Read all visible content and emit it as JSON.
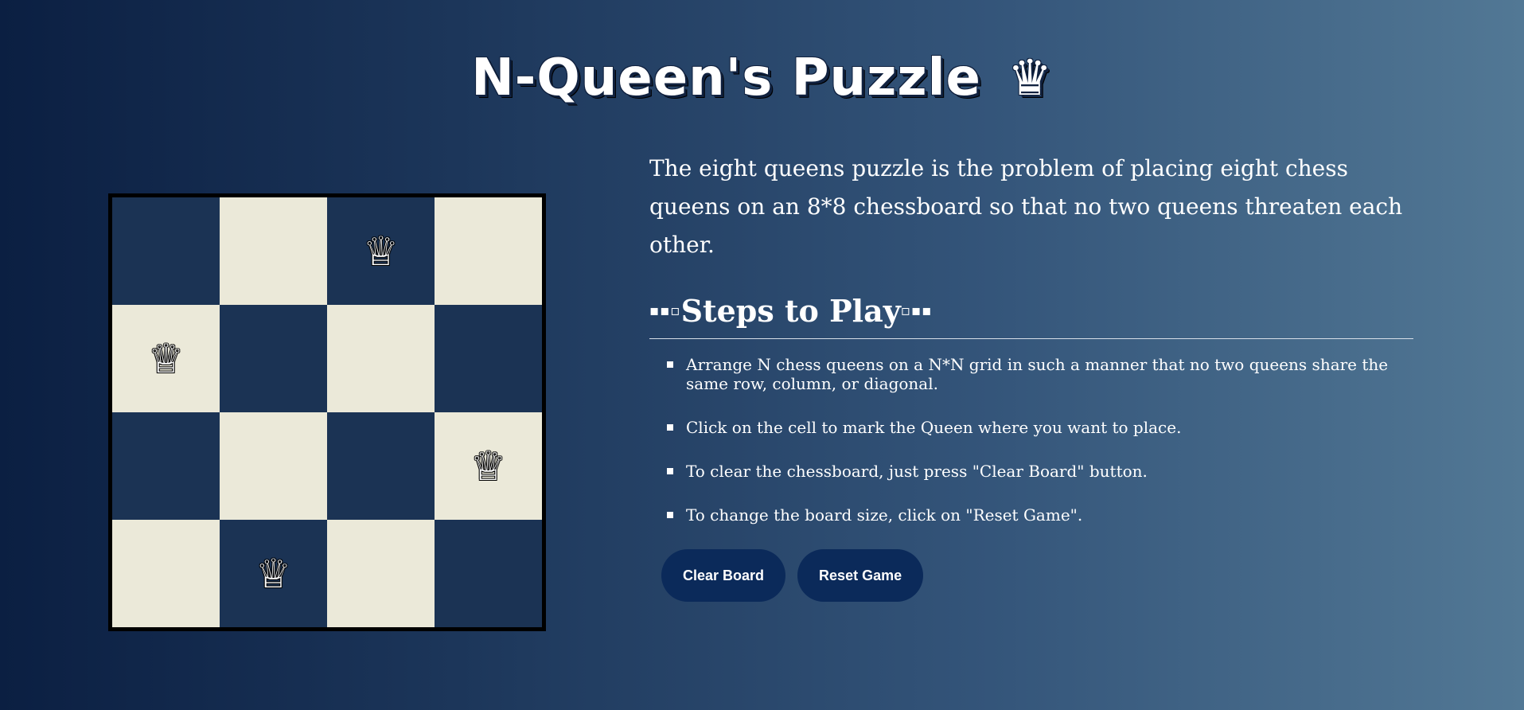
{
  "header": {
    "title": "N-Queen's Puzzle",
    "crown_icon": "♛"
  },
  "board": {
    "size": 4,
    "queen_glyph": "♕",
    "cells": [
      [
        "dark",
        "light",
        "dark",
        "light"
      ],
      [
        "light",
        "dark",
        "light",
        "dark"
      ],
      [
        "dark",
        "light",
        "dark",
        "light"
      ],
      [
        "light",
        "dark",
        "light",
        "dark"
      ]
    ],
    "queens": [
      {
        "row": 0,
        "col": 2
      },
      {
        "row": 1,
        "col": 0
      },
      {
        "row": 2,
        "col": 3
      },
      {
        "row": 3,
        "col": 1
      }
    ],
    "colors": {
      "dark": "#1b3354",
      "light": "#ebe9d9"
    }
  },
  "info": {
    "intro": "The eight queens puzzle is the problem of placing eight chess queens on an 8*8 chessboard so that no two queens threaten each other.",
    "steps_heading_prefix": "▪▪▫",
    "steps_heading": "Steps to Play",
    "steps_heading_suffix": "▫▪▪",
    "steps": [
      "Arrange N chess queens on a N*N grid in such a manner that no two queens share the same row, column, or diagonal.",
      "Click on the cell to mark the Queen where you want to place.",
      "To clear the chessboard, just press \"Clear Board\" button.",
      "To change the board size, click on \"Reset Game\"."
    ]
  },
  "buttons": {
    "clear_label": "Clear Board",
    "reset_label": "Reset Game",
    "color": "#0b2a5a"
  }
}
